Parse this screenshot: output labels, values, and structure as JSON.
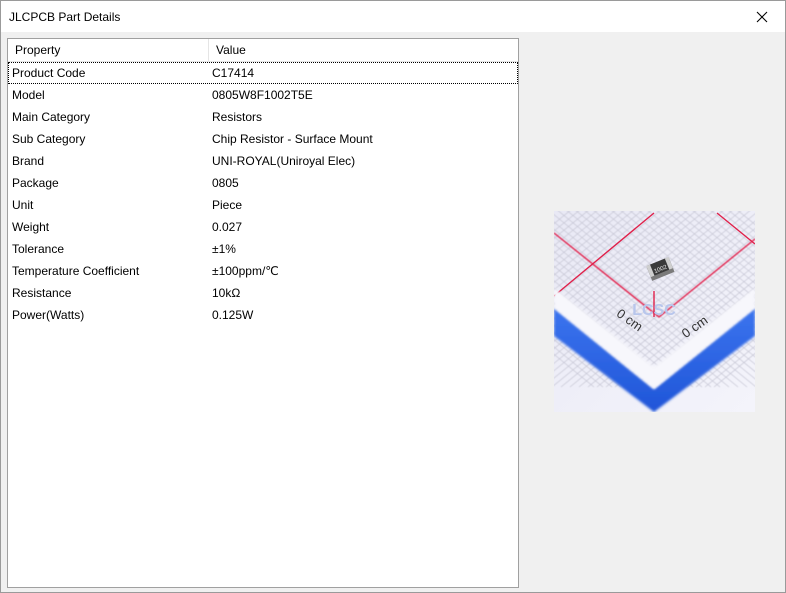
{
  "window": {
    "title": "JLCPCB Part Details",
    "close_icon": "close-icon"
  },
  "table": {
    "columns": [
      "Property",
      "Value"
    ],
    "rows": [
      {
        "property": "Product Code",
        "value": "C17414"
      },
      {
        "property": "Model",
        "value": "0805W8F1002T5E"
      },
      {
        "property": "Main Category",
        "value": "Resistors"
      },
      {
        "property": "Sub Category",
        "value": "Chip Resistor - Surface Mount"
      },
      {
        "property": "Brand",
        "value": "UNI-ROYAL(Uniroyal Elec)"
      },
      {
        "property": "Package",
        "value": "0805"
      },
      {
        "property": "Unit",
        "value": "Piece"
      },
      {
        "property": "Weight",
        "value": "0.027"
      },
      {
        "property": "Tolerance",
        "value": "±1%"
      },
      {
        "property": "Temperature Coefficient",
        "value": "±100ppm/℃"
      },
      {
        "property": "Resistance",
        "value": "10kΩ"
      },
      {
        "property": "Power(Watts)",
        "value": "0.125W"
      }
    ],
    "focused_row": 0
  },
  "part_image": {
    "marking": "1002",
    "ruler_label_left": "0 cm",
    "ruler_label_right": "0 cm",
    "watermark": "LCSC",
    "colors": {
      "background": "#eeeef8",
      "grid": "#c9c9d6",
      "red_line": "#e0204a",
      "blue_band": "#2a63e0"
    }
  }
}
